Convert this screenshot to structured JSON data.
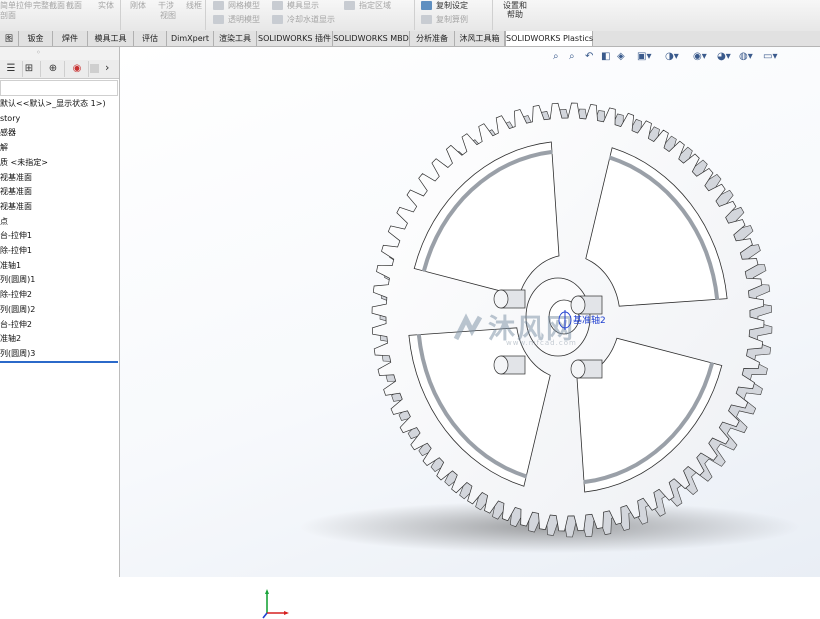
{
  "ribbon": {
    "group1": [
      "简单拉伸",
      "完整截面",
      "截面",
      "实体",
      "刚体",
      "干涉",
      "线框",
      "剖面",
      "视图"
    ],
    "r_mesh": "网格模型",
    "r_transparent": "透明模型",
    "r_mold": "模具显示",
    "r_cooling": "冷却水道显示",
    "r_region": "指定区域",
    "r_copy_settings": "复制设定",
    "r_copy_example": "复制算例",
    "r_settings_help": [
      "设置和",
      "帮助"
    ]
  },
  "tabs": [
    "图",
    "钣金",
    "焊件",
    "模具工具",
    "评估",
    "DimXpert",
    "渲染工具",
    "SOLIDWORKS 插件",
    "SOLIDWORKS MBD",
    "分析准备",
    "沐风工具箱",
    "SOLIDWORKS Plastics"
  ],
  "active_tab": "SOLIDWORKS Plastics",
  "panel": {
    "tab_icons": [
      "☰",
      "⊞",
      "⊕",
      "◉"
    ],
    "tree": [
      "默认<<默认>_显示状态 1>)",
      "story",
      "感器",
      "解",
      "质 <未指定>",
      "视基准面",
      "视基准面",
      "视基准面",
      "点",
      "台-拉伸1",
      "除-拉伸1",
      "准轴1",
      "列(圆周)1",
      "除-拉伸2",
      "列(圆周)2",
      "台-拉伸2",
      "准轴2",
      "列(圆周)3"
    ]
  },
  "viewport": {
    "annotation": "基准轴2",
    "watermark_title": "沐风网",
    "watermark_url": "www.mfcad.com",
    "gear_teeth": 64,
    "hud_icons": [
      "zoom-to-fit-icon",
      "zoom-area-icon",
      "previous-view-icon",
      "section-view-icon",
      "dynamic-annotation-icon",
      "view-orientation-icon",
      "display-style-icon",
      "hide-show-icon",
      "appearance-icon",
      "scene-icon",
      "view-setting-icon"
    ]
  },
  "colors": {
    "active_tab_bg": "#ffffff",
    "tree_underline": "#2b69c9",
    "annotation": "#1f3fd0",
    "axis_x": "#d62020",
    "axis_y": "#1aa33a",
    "axis_z": "#2040d0"
  }
}
